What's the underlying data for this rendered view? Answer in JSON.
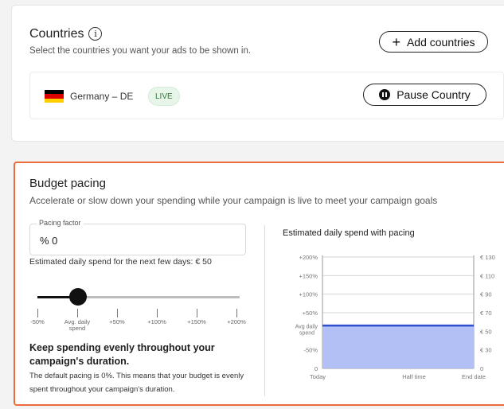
{
  "countries": {
    "title": "Countries",
    "info_icon": "i",
    "subtitle": "Select the countries you want your ads to be shown in.",
    "add_button": "Add countries",
    "add_icon": "+",
    "rows": [
      {
        "name": "Germany – DE",
        "status": "LIVE",
        "action": "Pause Country",
        "flag_colors": [
          "#000000",
          "#dd0000",
          "#ffce00"
        ]
      }
    ]
  },
  "budget": {
    "title": "Budget pacing",
    "subtitle": "Accelerate or slow down your spending while your campaign is live to meet your campaign goals",
    "pacing_field": {
      "label": "Pacing factor",
      "value": "% 0"
    },
    "estimate_text": "Estimated daily spend for the next few days: € 50",
    "slider": {
      "value_label": "Avg. daily spend",
      "position_fraction": 0.2,
      "ticks": [
        "-50%",
        "Avg. daily spend",
        "+50%",
        "+100%",
        "+150%",
        "+200%"
      ]
    },
    "keep_title": "Keep spending evenly throughout your campaign's duration.",
    "keep_text": "The default pacing is 0%. This means that your budget is evenly spent throughout your campaign's duration."
  },
  "chart_data": {
    "type": "area",
    "title": "Estimated daily spend with pacing",
    "y_left_labels": [
      "+200%",
      "+150%",
      "+100%",
      "+50%",
      "Avg daily spend",
      "-50%",
      "0"
    ],
    "y_right_labels": [
      "€ 130",
      "€ 110",
      "€ 90",
      "€ 70",
      "€ 50",
      "€ 30",
      "0"
    ],
    "x_labels": [
      "Today",
      "Half time",
      "End date"
    ],
    "series": [
      {
        "x": [
          "Today",
          "End date"
        ],
        "values": [
          50,
          50
        ]
      }
    ],
    "ylim": [
      0,
      130
    ],
    "accent_color": "#2f4fd1",
    "fill_color": "#b3c0f5"
  }
}
